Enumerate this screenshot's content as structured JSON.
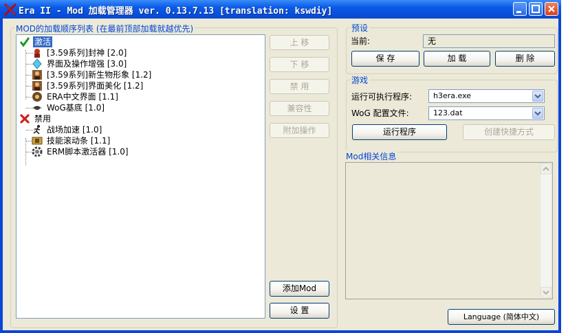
{
  "window": {
    "title": "Era II - Mod 加载管理器 ver. 0.13.7.13 [translation: kswdiy]",
    "icon": "crossed-swords-icon"
  },
  "mods_panel": {
    "label": "MOD的加载顺序列表 (在最前顶部加载就越优先)",
    "active_group": "激活",
    "active_mods": [
      {
        "label": "[3.59系列]封神 [2.0]",
        "icon": "red-knight-icon"
      },
      {
        "label": "界面及操作增强 [3.0]",
        "icon": "crystal-icon"
      },
      {
        "label": "[3.59系列]新生物形象 [1.2]",
        "icon": "portrait-icon"
      },
      {
        "label": "[3.59系列]界面美化 [1.2]",
        "icon": "portrait-icon"
      },
      {
        "label": "ERA中文界面 [1.1]",
        "icon": "gear-shield-icon"
      },
      {
        "label": "WoG基底 [1.0]",
        "icon": "black-bird-icon"
      }
    ],
    "disabled_group": "禁用",
    "disabled_mods": [
      {
        "label": "战场加速 [1.0]",
        "icon": "running-man-icon"
      },
      {
        "label": "技能滚动条 [1.1]",
        "icon": "scrollbar-icon"
      },
      {
        "label": "ERM脚本激活器 [1.0]",
        "icon": "cog-icon"
      }
    ]
  },
  "mod_buttons": {
    "move_up": "上 移",
    "move_down": "下 移",
    "disable": "禁 用",
    "compat": "兼容性",
    "extra": "附加操作",
    "add_mod": "添加Mod",
    "settings": "设 置"
  },
  "preset": {
    "label": "预设",
    "current_label": "当前:",
    "current_value": "无",
    "save": "保 存",
    "load": "加 载",
    "delete": "删 除"
  },
  "game": {
    "label": "游戏",
    "exe_label": "运行可执行程序:",
    "exe_value": "h3era.exe",
    "config_label": "WoG 配置文件:",
    "config_value": "123.dat",
    "run": "运行程序",
    "shortcut": "创建快捷方式"
  },
  "mod_info": {
    "label": "Mod相关信息"
  },
  "language_button": "Language (简体中文)"
}
